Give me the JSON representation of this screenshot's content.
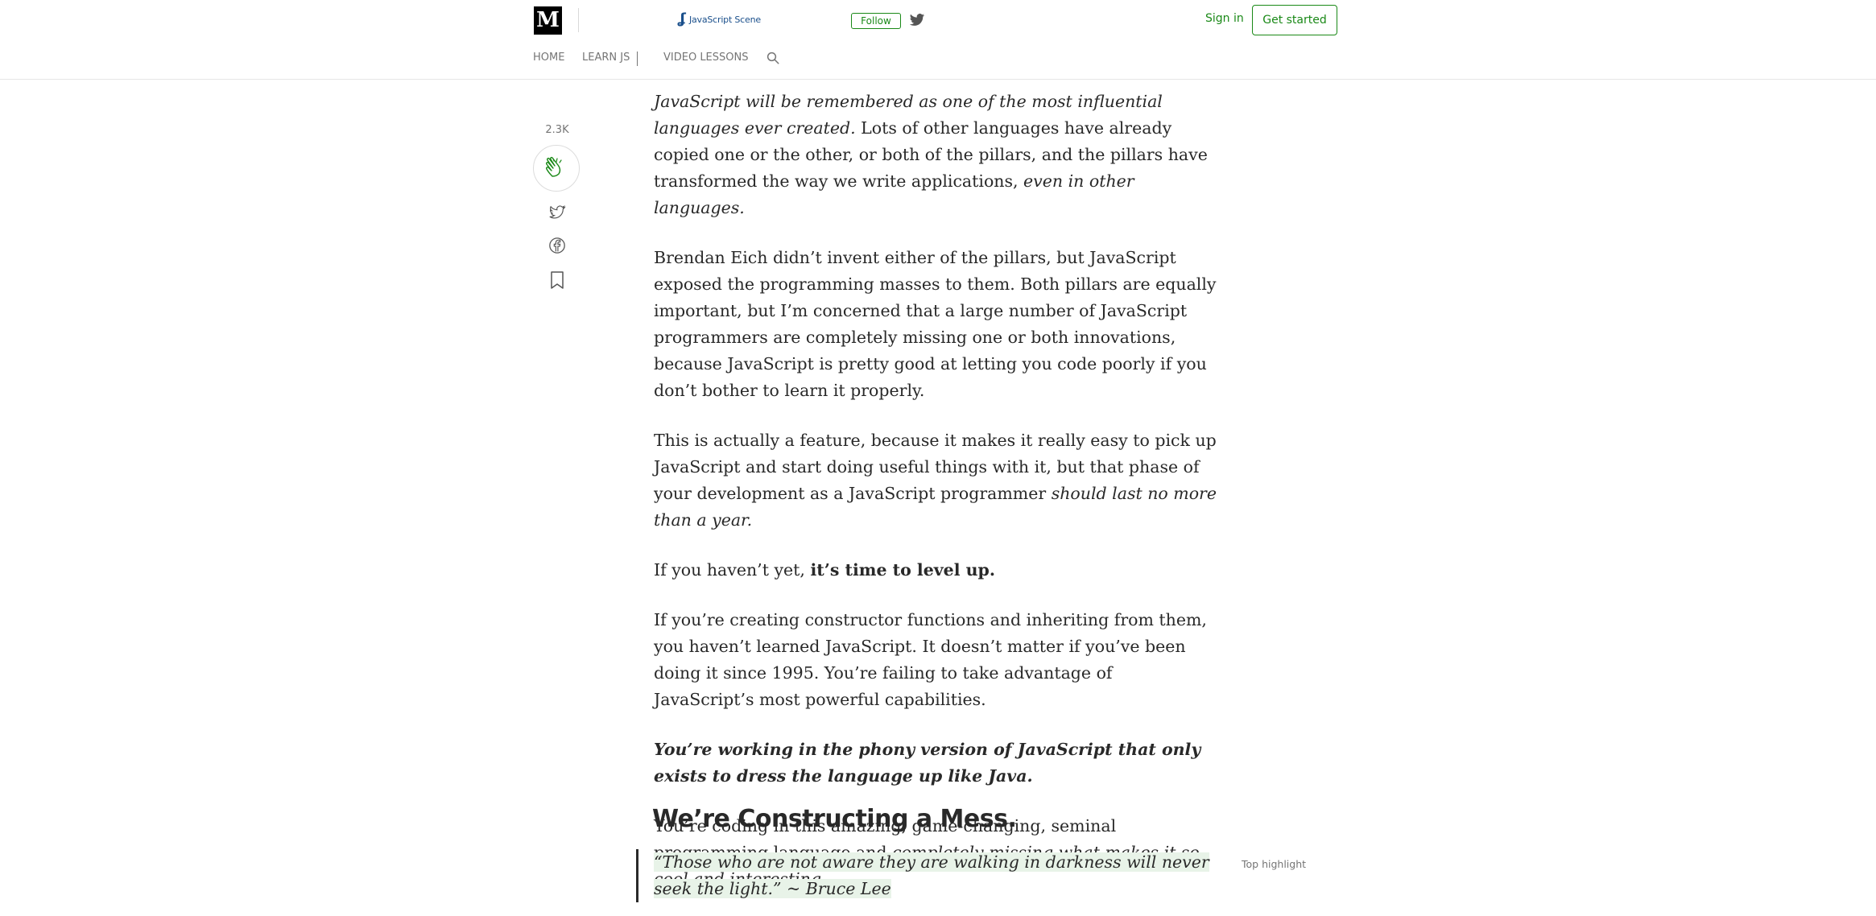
{
  "header": {
    "logo_letter": "M",
    "publication_name": "JavaScript Scene",
    "follow_label": "Follow",
    "signin_label": "Sign in",
    "get_started_label": "Get started"
  },
  "nav": {
    "items": [
      "HOME",
      "LEARN JS",
      "VIDEO LESSONS"
    ]
  },
  "rail": {
    "clap_count": "2.3K"
  },
  "article": {
    "p1_italic": "JavaScript will be remembered as one of the most influential languages ever created.",
    "p1_regular": " Lots of other languages have already copied one or the other, or both of the pillars, and the pillars have transformed the way we write applications, ",
    "p1_italic_end": "even in other languages.",
    "p2": "Brendan Eich didn’t invent either of the pillars, but JavaScript exposed the programming masses to them. Both pillars are equally important, but I’m concerned that a large number of JavaScript programmers are completely missing one or both innovations, because JavaScript is pretty good at letting you code poorly if you don’t bother to learn it properly.",
    "p3_regular": "This is actually a feature, because it makes it really easy to pick up JavaScript and start doing useful things with it, but that phase of your development as a JavaScript programmer ",
    "p3_italic": "should last no more than a year.",
    "p4_regular": "If you haven’t yet, ",
    "p4_bold": "it’s time to level up.",
    "p5": "If you’re creating constructor functions and inheriting from them, you haven’t learned JavaScript. It doesn’t matter if you’ve been doing it since 1995. You’re failing to take advantage of JavaScript’s most powerful capabilities.",
    "p6": "You’re working in the phony version of JavaScript that only exists to dress the language up like Java.",
    "p7_regular": "You’re coding in this amazing, game-changing, seminal programming language and ",
    "p7_italic": "completely missing what makes it so cool and interesting.",
    "heading": "We’re Constructing a Mess.",
    "quote": "“Those who are not aware they are walking in darkness will never seek the light.” ~ Bruce Lee",
    "top_highlight": "Top highlight"
  },
  "colors": {
    "accent_green": "#1a8917",
    "text": "#292929",
    "muted": "#757575",
    "highlight": "#e8f3e8"
  }
}
